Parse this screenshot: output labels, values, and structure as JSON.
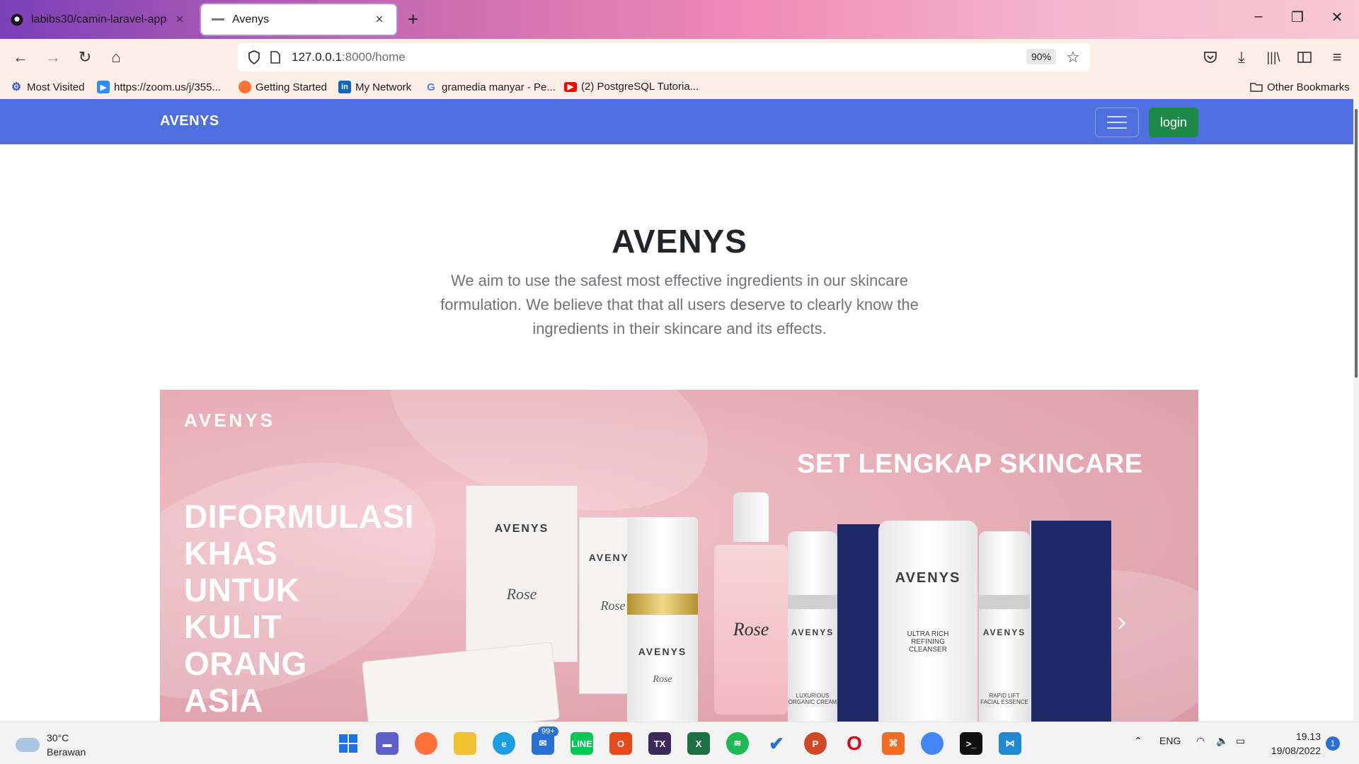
{
  "browser": {
    "tabs": [
      {
        "title": "labibs30/camin-laravel-app",
        "icon": "github-icon",
        "active": false
      },
      {
        "title": "Avenys",
        "icon": "avenys-favicon",
        "active": true
      }
    ],
    "url_host": "127.0.0.1",
    "url_path": ":8000/home",
    "zoom": "90%",
    "bookmarks": [
      {
        "label": "Most Visited",
        "icon": "gear-icon"
      },
      {
        "label": "https://zoom.us/j/355...",
        "icon": "zoom-icon"
      },
      {
        "label": "Getting Started",
        "icon": "firefox-icon"
      },
      {
        "label": "My Network",
        "icon": "linkedin-icon"
      },
      {
        "label": "gramedia manyar - Pe...",
        "icon": "google-icon"
      },
      {
        "label": "(2) PostgreSQL Tutoria...",
        "icon": "youtube-icon"
      }
    ],
    "other_bookmarks": "Other Bookmarks"
  },
  "site": {
    "brand": "AVENYS",
    "login_label": "login",
    "hero_title": "AVENYS",
    "hero_description": "We aim to use the safest most effective ingredients in our skincare formulation. We believe that that all users deserve to clearly know the ingredients in their skincare and its effects.",
    "banner": {
      "logo": "AVENYS",
      "set_text": "SET LENGKAP SKINCARE",
      "headline": "DIFORMULASI\nKHAS\nUNTUK\nKULIT\nORANG\nASIA",
      "products": [
        {
          "brand": "AVENYS",
          "sub": "Rose"
        },
        {
          "brand": "AVENYS",
          "sub": "Rose"
        },
        {
          "brand": "AVENYS",
          "sub": "Rose"
        },
        {
          "brand": "AVENYS",
          "sub": "Rose"
        },
        {
          "brand": "AVENYS",
          "sub": "LUXURIOUS ORGANIC CREAM"
        },
        {
          "brand": "AVENYS",
          "sub": "ULTRA RICH REFINING CLEANSER"
        },
        {
          "brand": "AVENYS",
          "sub": "RAPID LIFT FACIAL ESSENCE"
        }
      ],
      "next_arrow": "›"
    }
  },
  "taskbar": {
    "weather_temp": "30°C",
    "weather_desc": "Berawan",
    "mail_badge": "99+",
    "language": "ENG",
    "time": "19.13",
    "date": "19/08/2022",
    "notifications": "1"
  },
  "colors": {
    "site_nav": "#4f6fde",
    "login_button": "#1e8a4a",
    "banner_bg": "#e8b0b8"
  }
}
